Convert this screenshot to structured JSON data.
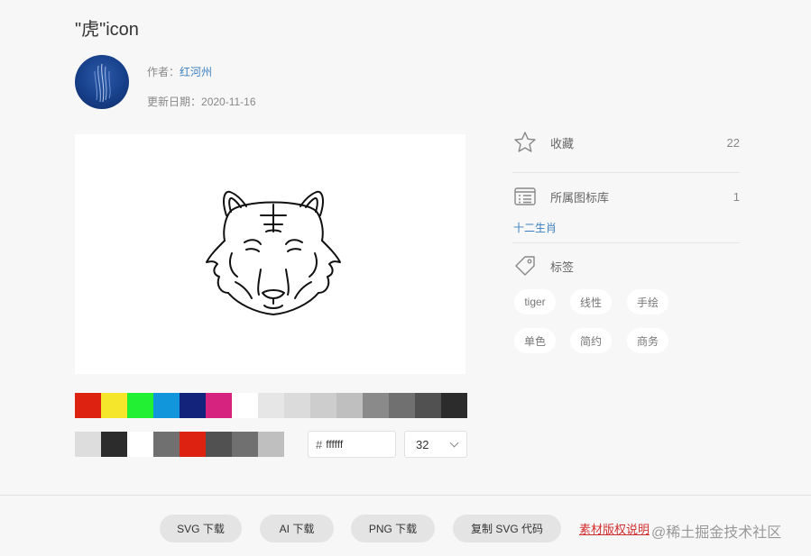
{
  "title": "\"虎\"icon",
  "author": {
    "label": "作者：",
    "name": "红河州"
  },
  "update": {
    "label": "更新日期：",
    "date": "2020-11-16"
  },
  "colors": {
    "row1": [
      "#dd2211",
      "#f5e62c",
      "#22f032",
      "#1296db",
      "#13227a",
      "#d6237f",
      "#ffffff",
      "#e6e6e6",
      "#dbdbdb",
      "#cdcdcd",
      "#bfbfbf",
      "#8a8a8a",
      "#707070",
      "#515151",
      "#2c2c2c"
    ],
    "row2": [
      "#dddddd",
      "#2c2c2c",
      "#ffffff",
      "#707070",
      "#dd2211",
      "#515151",
      "#707070",
      "#bfbfbf"
    ]
  },
  "hex_input": {
    "hash": "#",
    "value": "ffffff"
  },
  "size_select": {
    "value": "32"
  },
  "sidebar": {
    "favorite": {
      "label": "收藏",
      "count": "22"
    },
    "library": {
      "label": "所属图标库",
      "count": "1",
      "link": "十二生肖"
    },
    "tags_label": "标签",
    "tags": [
      "tiger",
      "线性",
      "手绘",
      "单色",
      "简约",
      "商务"
    ]
  },
  "buttons": {
    "svg": "SVG 下载",
    "ai": "AI 下载",
    "png": "PNG 下载",
    "copy_svg": "复制 SVG 代码"
  },
  "rights_link": "素材版权说明",
  "watermark": "@稀土掘金技术社区"
}
